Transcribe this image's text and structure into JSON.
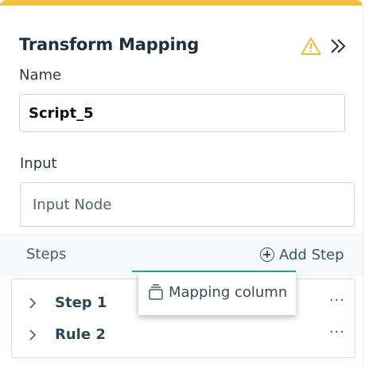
{
  "panel": {
    "title": "Transform Mapping",
    "accent_color": "#f3c03d",
    "warning_icon": "warning-icon",
    "collapse_icon": "double-chevron-right-icon"
  },
  "name_field": {
    "label": "Name",
    "value": "Script_5"
  },
  "input_field": {
    "label": "Input",
    "placeholder": "Input Node"
  },
  "steps": {
    "label": "Steps",
    "add_label": "Add Step",
    "items": [
      {
        "label": "Step 1",
        "more": "···"
      },
      {
        "label": "Rule 2",
        "more": "···"
      }
    ]
  },
  "dropdown": {
    "items": [
      {
        "label": "Mapping column",
        "icon": "stack-icon"
      }
    ],
    "accent_color": "#2aa7a5"
  }
}
